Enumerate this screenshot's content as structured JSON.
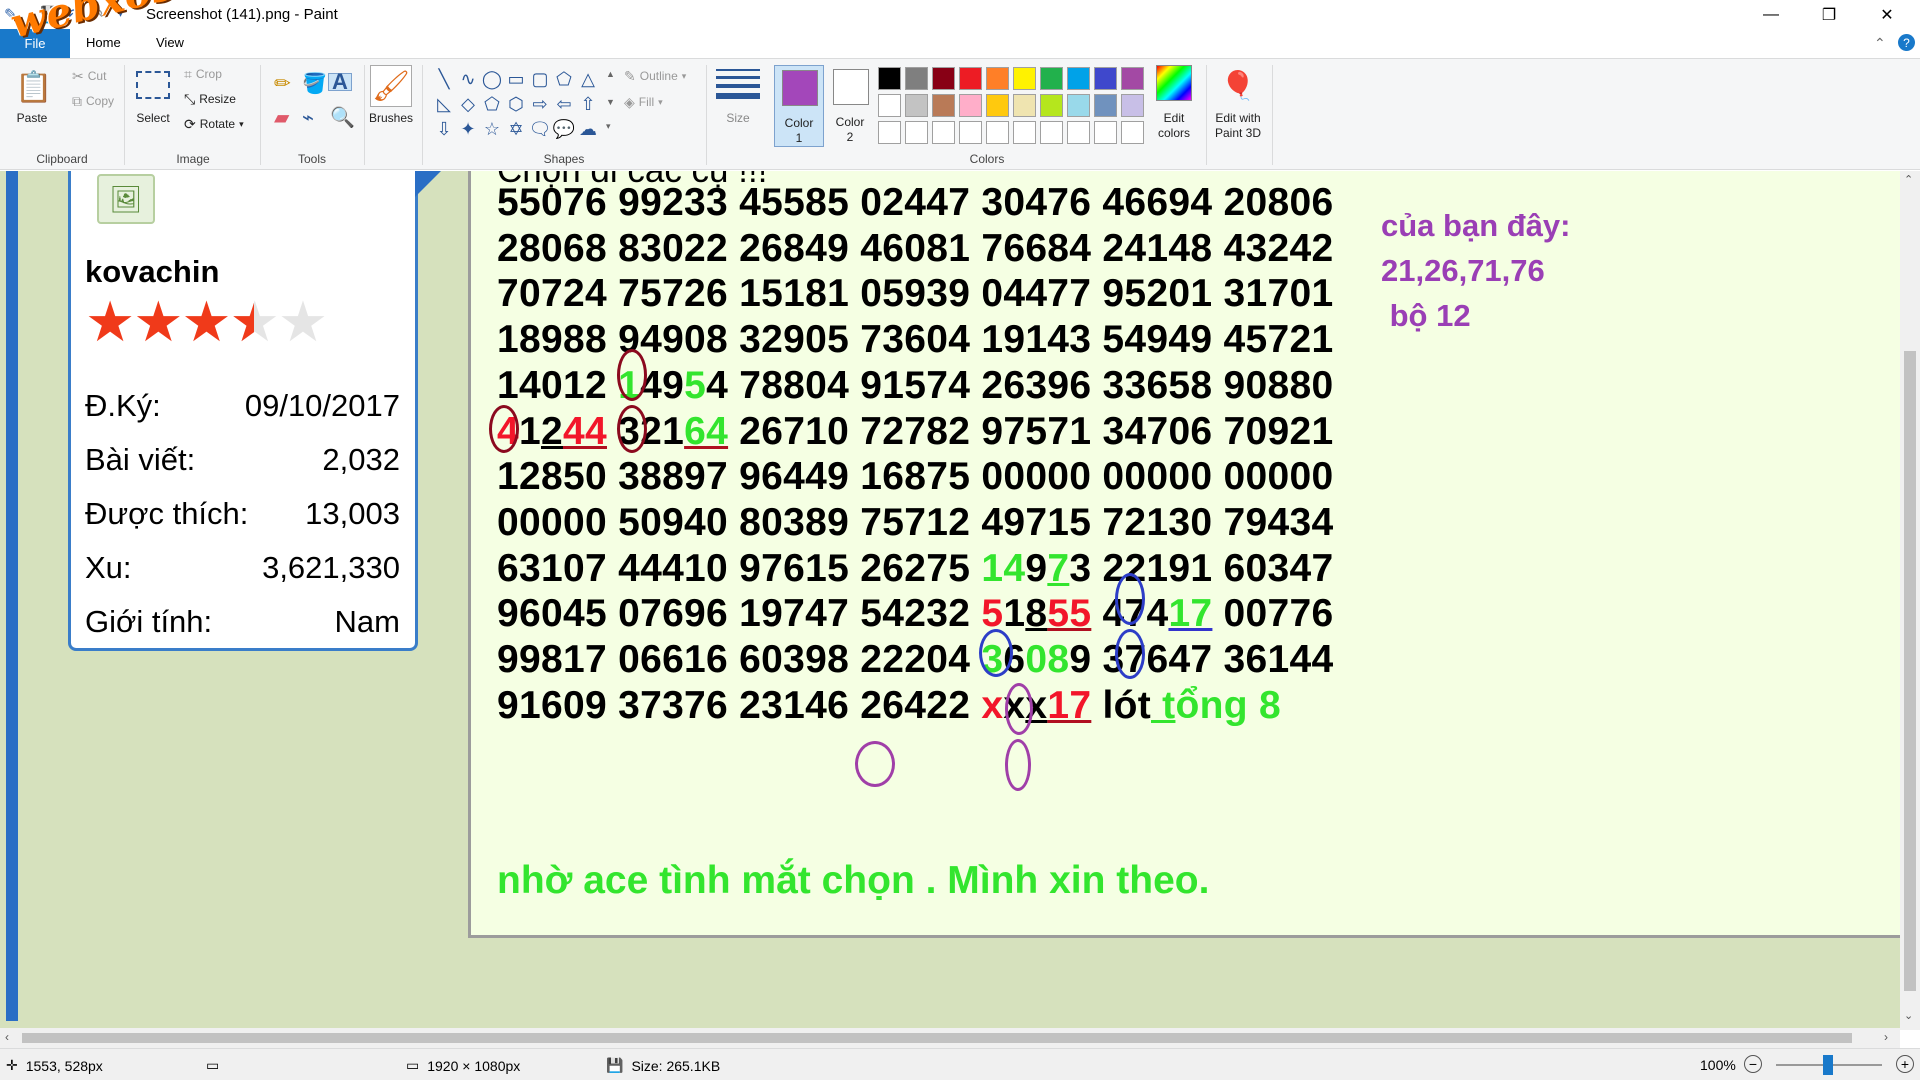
{
  "window": {
    "title": "Screenshot (141).png - Paint",
    "watermark": "webxoso.net",
    "minimize": "—",
    "restore": "❐",
    "close": "✕"
  },
  "tabs": {
    "file": "File",
    "home": "Home",
    "view": "View"
  },
  "ribbon": {
    "clipboard": {
      "paste": "Paste",
      "cut": "Cut",
      "copy": "Copy",
      "label": "Clipboard"
    },
    "image": {
      "select": "Select",
      "crop": "Crop",
      "resize": "Resize",
      "rotate": "Rotate",
      "label": "Image"
    },
    "tools": {
      "label": "Tools"
    },
    "brushes": "Brushes",
    "shapes": {
      "outline": "Outline",
      "fill": "Fill",
      "label": "Shapes"
    },
    "size": "Size",
    "color1": "Color\n1",
    "color1_a": "Color",
    "color1_b": "1",
    "color2_a": "Color",
    "color2_b": "2",
    "edit_colors_a": "Edit",
    "edit_colors_b": "colors",
    "paint3d_a": "Edit with",
    "paint3d_b": "Paint 3D",
    "colors_label": "Colors",
    "color1_value": "#a347ba",
    "color2_value": "#ffffff",
    "palette": [
      "#000000",
      "#7f7f7f",
      "#880015",
      "#ed1c24",
      "#ff7f27",
      "#fff200",
      "#22b14c",
      "#00a2e8",
      "#3f48cc",
      "#a349a4",
      "#ffffff",
      "#c3c3c3",
      "#b97a57",
      "#ffaec9",
      "#ffc90e",
      "#efe4b0",
      "#b5e61d",
      "#99d9ea",
      "#7092be",
      "#c8bfe7",
      "#ffffff",
      "#ffffff",
      "#ffffff",
      "#ffffff",
      "#ffffff",
      "#ffffff",
      "#ffffff",
      "#ffffff",
      "#ffffff",
      "#ffffff"
    ]
  },
  "profile": {
    "username": "kovachin",
    "stats": [
      {
        "label": "Đ.Ký:",
        "value": "09/10/2017"
      },
      {
        "label": "Bài viết:",
        "value": "2,032"
      },
      {
        "label": "Được thích:",
        "value": "13,003"
      },
      {
        "label": "Xu:",
        "value": "3,621,330"
      },
      {
        "label": "Giới tính:",
        "value": "Nam"
      }
    ],
    "rating_stars": 3.5
  },
  "post": {
    "title": "Chọn đi các cụ !!!",
    "lines": [
      "55076 99233 45585 02447 30476 46694 20806",
      "28068 83022 26849 46081 76684 24148 43242",
      "70724 75726 15181 05939 04477 95201 31701",
      "18988 94908 32905 73604 19143 54949 45721",
      "14012 14954 78804 91574 26396 33658 90880",
      "41244 32164 26710 72782 97571 34706 70921",
      "12850 38897 96449 16875 00000 00000 00000",
      "00000 50940 80389 75712 49715 72130 79434",
      "63107 44410 97615 26275 14973 22191 60347",
      "96045 07696 19747 54232 51855 47417 00776",
      "99817 06616 60398 22204 36089 37647 36144",
      "91609 37376 23146 26422 xxx17 lót tổng 8"
    ],
    "side_note": [
      "của bạn đây:",
      "21,26,71,76",
      " bộ 12"
    ],
    "closing": "nhờ ace tình mắt chọn . Mình xin theo."
  },
  "status": {
    "cursor": "1553, 528px",
    "dimensions": "1920 × 1080px",
    "size": "Size: 265.1KB",
    "zoom": "100%",
    "zoom_level": 100
  }
}
